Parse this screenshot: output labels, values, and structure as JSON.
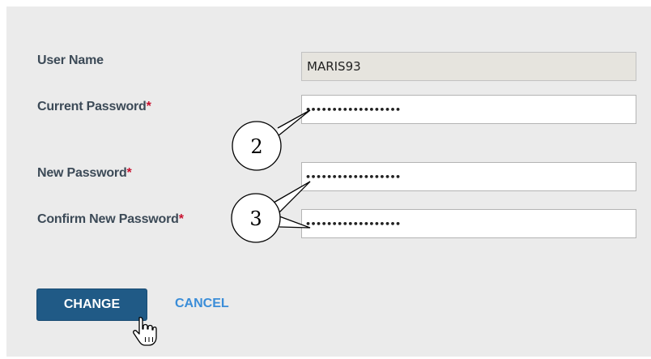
{
  "form": {
    "username": {
      "label": "User Name",
      "value": "MARIS93"
    },
    "current_password": {
      "label": "Current Password",
      "required_marker": "*",
      "value": "••••••••••••••••••"
    },
    "new_password": {
      "label": "New Password",
      "required_marker": "*",
      "value": "••••••••••••••••••"
    },
    "confirm_password": {
      "label": "Confirm New Password",
      "required_marker": "*",
      "value": "••••••••••••••••••"
    }
  },
  "actions": {
    "change_label": "CHANGE",
    "cancel_label": "CANCEL"
  },
  "callouts": {
    "current_password_step": "2",
    "new_password_step": "3"
  },
  "colors": {
    "panel_background": "#ebebeb",
    "label_text": "#3c4a57",
    "required_marker": "#c8102e",
    "primary_button": "#205a86",
    "link": "#3a8dd8"
  },
  "icons": {
    "cursor": "hand-pointer-icon"
  }
}
